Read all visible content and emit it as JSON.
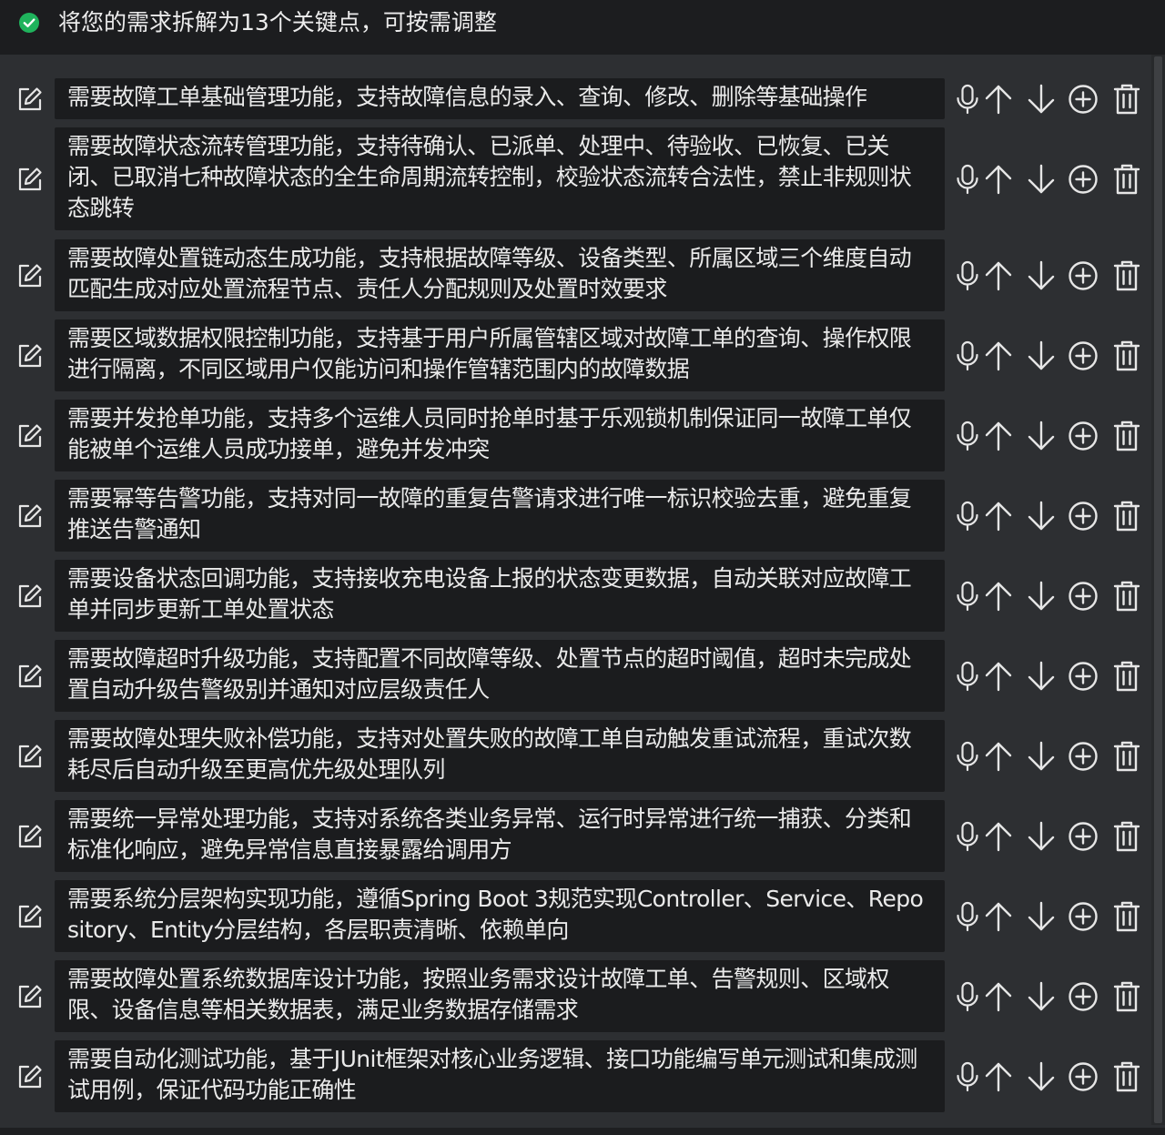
{
  "header": {
    "title": "将您的需求拆解为13个关键点，可按需调整",
    "status_icon": "check-circle-icon",
    "status_color": "#1fb35c"
  },
  "colors": {
    "panel_bg": "#2d2f32",
    "item_bg": "#1b1c1e",
    "icon": "#e6e6e6"
  },
  "row_icons": {
    "edit": "edit-icon",
    "mic": "microphone-icon",
    "up": "arrow-up-icon",
    "down": "arrow-down-icon",
    "add": "plus-circle-icon",
    "delete": "trash-icon"
  },
  "items": [
    {
      "text": "需要故障工单基础管理功能，支持故障信息的录入、查询、修改、删除等基础操作"
    },
    {
      "text": "需要故障状态流转管理功能，支持待确认、已派单、处理中、待验收、已恢复、已关闭、已取消七种故障状态的全生命周期流转控制，校验状态流转合法性，禁止非规则状态跳转"
    },
    {
      "text": "需要故障处置链动态生成功能，支持根据故障等级、设备类型、所属区域三个维度自动匹配生成对应处置流程节点、责任人分配规则及处置时效要求"
    },
    {
      "text": "需要区域数据权限控制功能，支持基于用户所属管辖区域对故障工单的查询、操作权限进行隔离，不同区域用户仅能访问和操作管辖范围内的故障数据"
    },
    {
      "text": "需要并发抢单功能，支持多个运维人员同时抢单时基于乐观锁机制保证同一故障工单仅能被单个运维人员成功接单，避免并发冲突"
    },
    {
      "text": "需要幂等告警功能，支持对同一故障的重复告警请求进行唯一标识校验去重，避免重复推送告警通知"
    },
    {
      "text": "需要设备状态回调功能，支持接收充电设备上报的状态变更数据，自动关联对应故障工单并同步更新工单处置状态"
    },
    {
      "text": "需要故障超时升级功能，支持配置不同故障等级、处置节点的超时阈值，超时未完成处置自动升级告警级别并通知对应层级责任人"
    },
    {
      "text": "需要故障处理失败补偿功能，支持对处置失败的故障工单自动触发重试流程，重试次数耗尽后自动升级至更高优先级处理队列"
    },
    {
      "text": "需要统一异常处理功能，支持对系统各类业务异常、运行时异常进行统一捕获、分类和标准化响应，避免异常信息直接暴露给调用方"
    },
    {
      "text": "需要系统分层架构实现功能，遵循Spring Boot 3规范实现Controller、Service、Repository、Entity分层结构，各层职责清晰、依赖单向"
    },
    {
      "text": "需要故障处置系统数据库设计功能，按照业务需求设计故障工单、告警规则、区域权限、设备信息等相关数据表，满足业务数据存储需求"
    },
    {
      "text": "需要自动化测试功能，基于JUnit框架对核心业务逻辑、接口功能编写单元测试和集成测试用例，保证代码功能正确性"
    }
  ]
}
